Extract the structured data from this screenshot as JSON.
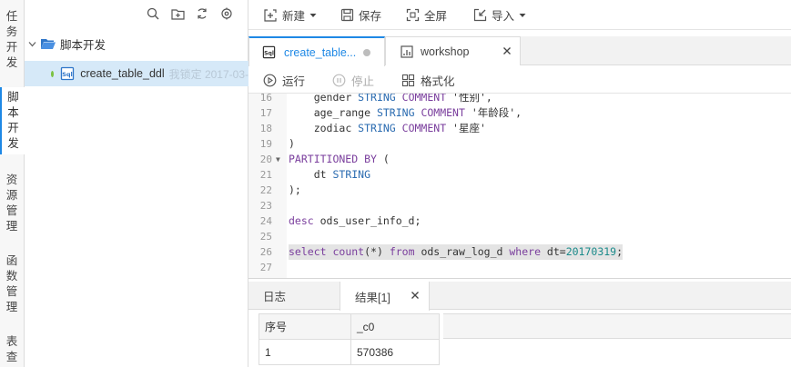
{
  "nav": {
    "items": [
      {
        "label": "任务开发"
      },
      {
        "label": "脚本开发"
      },
      {
        "label": "资源管理"
      },
      {
        "label": "函数管理"
      },
      {
        "label": "表查"
      }
    ]
  },
  "tree": {
    "folder": "脚本开发",
    "file": {
      "name": "create_table_ddl",
      "lock": "我锁定 2017-03-"
    }
  },
  "toolbar": {
    "new": "新建",
    "save": "保存",
    "fullscreen": "全屏",
    "import": "导入"
  },
  "tabs": [
    {
      "label": "create_table..."
    },
    {
      "label": "workshop"
    }
  ],
  "runbar": {
    "run": "运行",
    "stop": "停止",
    "format": "格式化"
  },
  "editor": {
    "lines": [
      {
        "no": "16",
        "indent": "    ",
        "tokens": [
          [
            "",
            "gender "
          ],
          [
            "ty",
            "STRING"
          ],
          [
            "",
            " "
          ],
          [
            "kw",
            "COMMENT"
          ],
          [
            "st",
            " '性别',"
          ]
        ]
      },
      {
        "no": "17",
        "indent": "    ",
        "tokens": [
          [
            "",
            "age_range "
          ],
          [
            "ty",
            "STRING"
          ],
          [
            "",
            " "
          ],
          [
            "kw",
            "COMMENT"
          ],
          [
            "st",
            " '年龄段',"
          ]
        ]
      },
      {
        "no": "18",
        "indent": "    ",
        "tokens": [
          [
            "",
            "zodiac "
          ],
          [
            "ty",
            "STRING"
          ],
          [
            "",
            " "
          ],
          [
            "kw",
            "COMMENT"
          ],
          [
            "st",
            " '星座'"
          ]
        ]
      },
      {
        "no": "19",
        "indent": "",
        "tokens": [
          [
            "",
            ")"
          ]
        ]
      },
      {
        "no": "20",
        "indent": "",
        "fold": true,
        "tokens": [
          [
            "kw",
            "PARTITIONED BY"
          ],
          [
            "",
            " ("
          ]
        ]
      },
      {
        "no": "21",
        "indent": "    ",
        "tokens": [
          [
            "",
            "dt "
          ],
          [
            "ty",
            "STRING"
          ]
        ]
      },
      {
        "no": "22",
        "indent": "",
        "tokens": [
          [
            "",
            ");"
          ]
        ]
      },
      {
        "no": "23",
        "indent": "",
        "tokens": []
      },
      {
        "no": "24",
        "indent": "",
        "tokens": [
          [
            "kw",
            "desc"
          ],
          [
            "",
            " ods_user_info_d;"
          ]
        ]
      },
      {
        "no": "25",
        "indent": "",
        "tokens": []
      },
      {
        "no": "26",
        "indent": "",
        "highlight": true,
        "tokens": [
          [
            "kw",
            "select"
          ],
          [
            "",
            " "
          ],
          [
            "kw",
            "count"
          ],
          [
            "",
            "(*) "
          ],
          [
            "kw",
            "from"
          ],
          [
            "",
            " ods_raw_log_d "
          ],
          [
            "kw",
            "where"
          ],
          [
            "",
            " dt="
          ],
          [
            "nm",
            "20170319"
          ],
          [
            "",
            ";"
          ]
        ]
      },
      {
        "no": "27",
        "indent": "",
        "tokens": []
      }
    ]
  },
  "bottom": {
    "tabs": [
      {
        "label": "日志"
      },
      {
        "label": "结果[1]"
      }
    ],
    "table": {
      "headers": [
        "序号",
        "_c0"
      ],
      "rows": [
        [
          "1",
          "570386"
        ]
      ]
    }
  }
}
